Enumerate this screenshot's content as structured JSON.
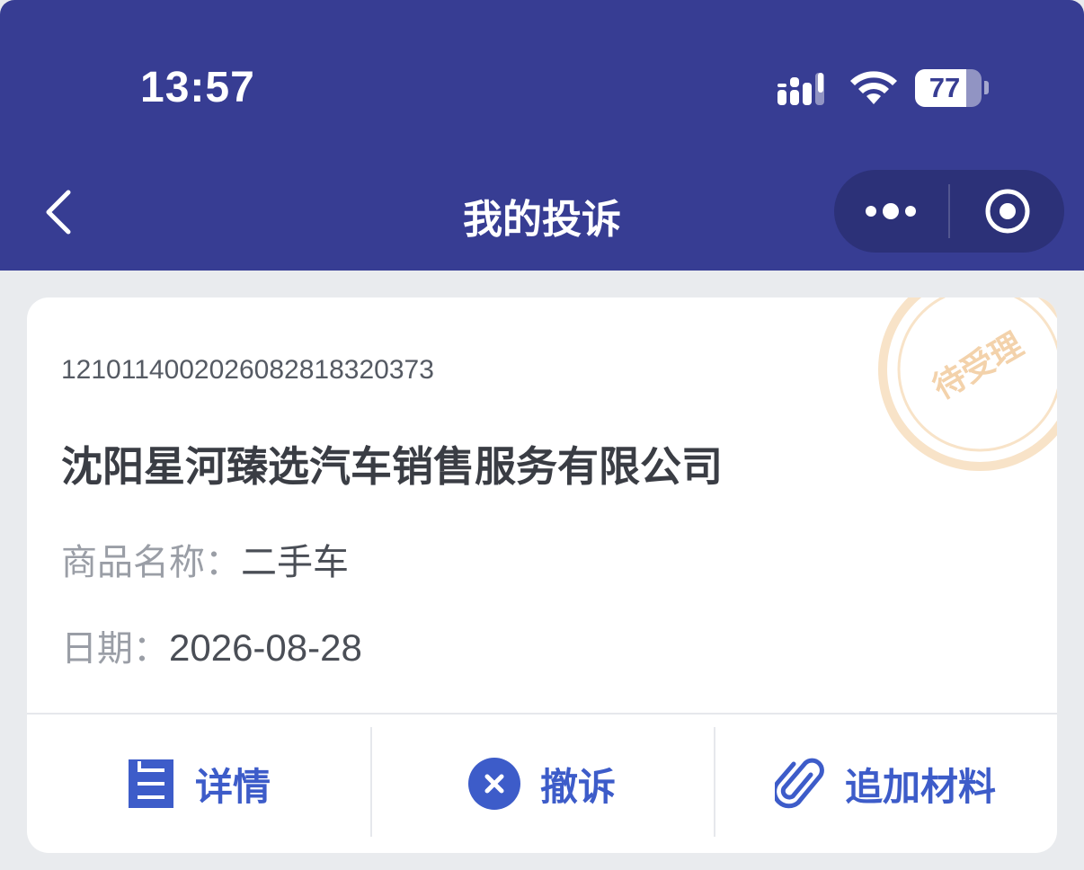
{
  "status_bar": {
    "time": "13:57",
    "battery_level": "77",
    "icons": [
      "signal-icon",
      "wifi-icon",
      "battery-icon"
    ]
  },
  "nav": {
    "title": "我的投诉",
    "back_icon": "chevron-left-icon",
    "more_icon": "more-dots-icon",
    "close_icon": "target-circle-icon"
  },
  "complaint": {
    "order_no": "12101140020260828183203​73",
    "company": "沈阳星河臻选汽车销售服务有限公司",
    "product_label": "商品名称：",
    "product_value": "二手车",
    "date_label": "日期：",
    "date_value": "2026-08-28",
    "status_stamp": "待受理"
  },
  "actions": [
    {
      "label": "详情",
      "icon": "document-icon"
    },
    {
      "label": "撤诉",
      "icon": "close-circle-icon"
    },
    {
      "label": "追加材料",
      "icon": "paperclip-icon"
    }
  ],
  "colors": {
    "header_bg": "#373d93",
    "accent": "#3d5cc9",
    "stamp": "#f6ddbe",
    "page_bg": "#e9ebee"
  }
}
